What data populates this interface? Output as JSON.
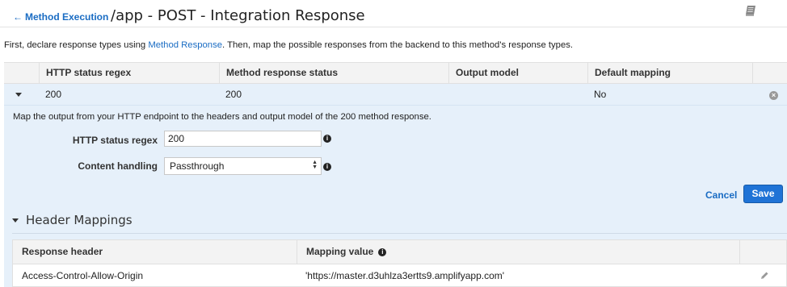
{
  "header": {
    "back_label": "Method Execution",
    "title": "/app - POST - Integration Response"
  },
  "intro": {
    "prefix": "First, declare response types using ",
    "link": "Method Response",
    "suffix": ". Then, map the possible responses from the backend to this method's response types."
  },
  "table": {
    "columns": [
      "HTTP status regex",
      "Method response status",
      "Output model",
      "Default mapping"
    ],
    "row": {
      "status_regex": "200",
      "method_response_status": "200",
      "output_model": "",
      "default_mapping": "No"
    }
  },
  "panel": {
    "description": "Map the output from your HTTP endpoint to the headers and output model of the 200 method response.",
    "regex_label": "HTTP status regex",
    "regex_value": "200",
    "content_label": "Content handling",
    "content_value": "Passthrough",
    "cancel_label": "Cancel",
    "save_label": "Save"
  },
  "header_mappings": {
    "title": "Header Mappings",
    "columns": [
      "Response header",
      "Mapping value"
    ],
    "rows": [
      {
        "header": "Access-Control-Allow-Origin",
        "value": "'https://master.d3uhlza3ertts9.amplifyapp.com'"
      }
    ]
  },
  "colors": {
    "link": "#1a6cc3",
    "row_highlight": "#e6f0fa",
    "save_button": "#1f73d6"
  },
  "icons": {
    "back": "arrow-left-icon",
    "help": "book-icon",
    "expand": "caret-down-icon",
    "remove": "remove-circle-icon",
    "info": "info-icon",
    "edit": "pencil-icon"
  }
}
